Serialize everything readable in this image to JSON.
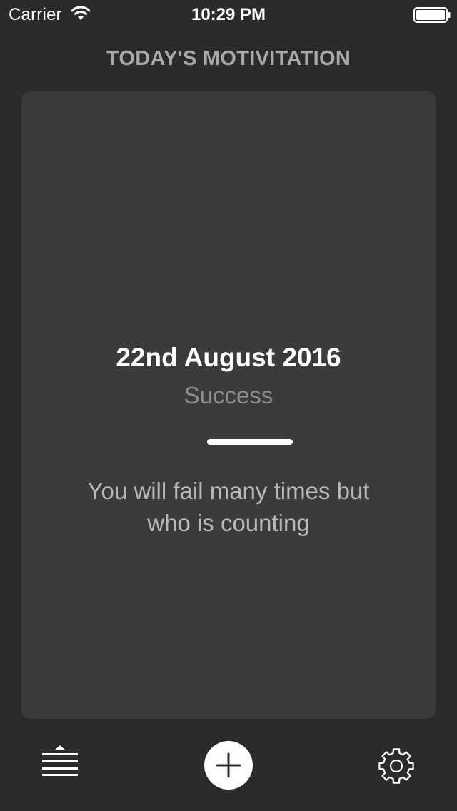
{
  "status_bar": {
    "carrier": "Carrier",
    "time": "10:29 PM"
  },
  "header": {
    "title": "TODAY'S MOTIVITATION"
  },
  "card": {
    "date": "22nd August 2016",
    "category": "Success",
    "quote": "You will fail many times but who is counting"
  },
  "toolbar": {
    "left_icon": "stack-menu-icon",
    "center_icon": "plus-icon",
    "right_icon": "gear-icon"
  },
  "colors": {
    "background": "#2b2b2b",
    "card": "#3b3b3b",
    "title": "#a8a8a8",
    "category": "#8c8c8c",
    "quote": "#b8b8b8",
    "accent": "#ffffff"
  }
}
